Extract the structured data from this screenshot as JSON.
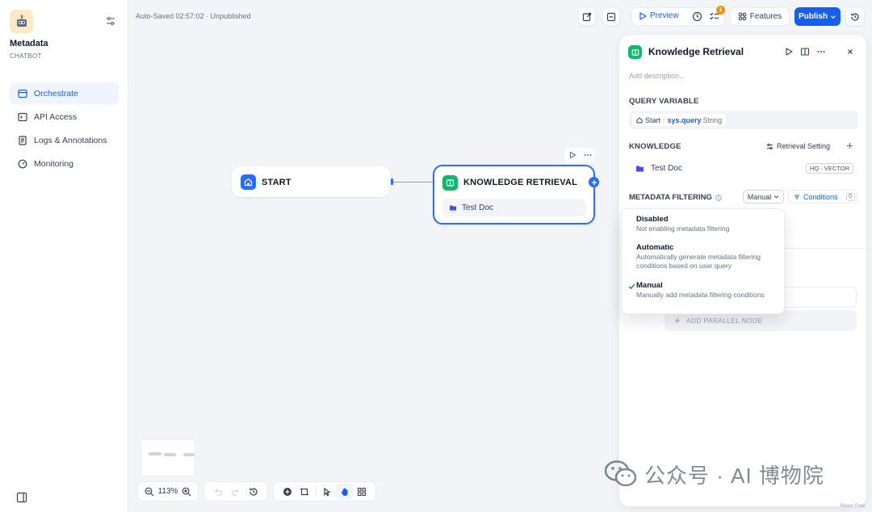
{
  "app": {
    "name": "Metadata",
    "type": "CHATBOT"
  },
  "nav": [
    {
      "label": "Orchestrate",
      "active": true
    },
    {
      "label": "API Access",
      "active": false
    },
    {
      "label": "Logs & Annotations",
      "active": false
    },
    {
      "label": "Monitoring",
      "active": false
    }
  ],
  "topbar": {
    "autosave": "Auto-Saved 02:57:02 · Unpublished",
    "preview": "Preview",
    "checklist_badge": "1",
    "features": "Features",
    "publish": "Publish"
  },
  "canvas": {
    "start_title": "START",
    "kr_title": "KNOWLEDGE RETRIEVAL",
    "kr_doc": "Test Doc",
    "zoom": "113%"
  },
  "panel": {
    "title": "Knowledge Retrieval",
    "description_placeholder": "Add description...",
    "query_variable_label": "QUERY VARIABLE",
    "qv_node": "Start",
    "qv_var": "sys.query",
    "qv_type": "String",
    "knowledge_label": "KNOWLEDGE",
    "retrieval_setting": "Retrieval Setting",
    "knowledge_item": "Test Doc",
    "knowledge_tag": "HQ · VECTOR",
    "metadata_label": "METADATA FILTERING",
    "mode": "Manual",
    "conditions": "Conditions",
    "conditions_count": "0",
    "add_parallel": "ADD PARALLEL NODE"
  },
  "dropdown": [
    {
      "title": "Disabled",
      "desc": "Not enabling metadata filtering",
      "selected": false
    },
    {
      "title": "Automatic",
      "desc": "Automatically generate metadata filtering conditions based on user query",
      "selected": false
    },
    {
      "title": "Manual",
      "desc": "Manually add metadata filtering conditions",
      "selected": true
    }
  ],
  "watermark": "公众号 · AI 博物院",
  "corner_text": "React Flow",
  "colors": {
    "primary": "#155eef",
    "node_green": "#12b76a",
    "start_blue": "#296dff",
    "badge": "#f79009"
  }
}
